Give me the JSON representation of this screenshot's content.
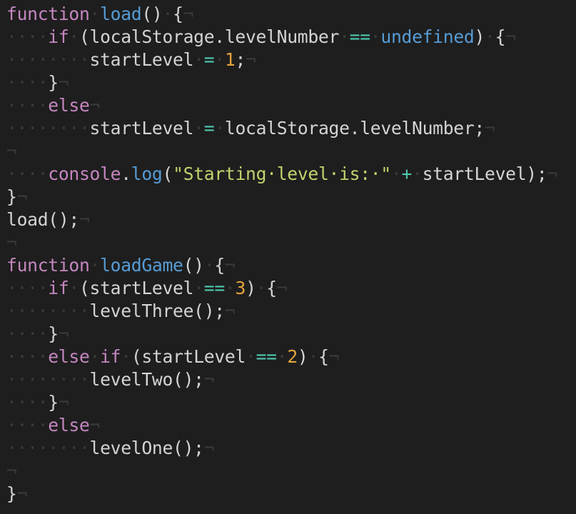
{
  "editor": {
    "lines": [
      [
        {
          "t": "function",
          "c": "kw"
        },
        {
          "t": "·",
          "c": "ws"
        },
        {
          "t": "load",
          "c": "fn"
        },
        {
          "t": "()",
          "c": "punc"
        },
        {
          "t": "·",
          "c": "ws"
        },
        {
          "t": "{",
          "c": "punc"
        },
        {
          "t": "¬",
          "c": "eol"
        }
      ],
      [
        {
          "t": "····",
          "c": "ws"
        },
        {
          "t": "if",
          "c": "kw"
        },
        {
          "t": "·",
          "c": "ws"
        },
        {
          "t": "(localStorage.levelNumber",
          "c": "punc"
        },
        {
          "t": "·",
          "c": "ws"
        },
        {
          "t": "==",
          "c": "op"
        },
        {
          "t": "·",
          "c": "ws"
        },
        {
          "t": "undefined",
          "c": "undef"
        },
        {
          "t": ")",
          "c": "punc"
        },
        {
          "t": "·",
          "c": "ws"
        },
        {
          "t": "{",
          "c": "punc"
        },
        {
          "t": "¬",
          "c": "eol"
        }
      ],
      [
        {
          "t": "········",
          "c": "ws"
        },
        {
          "t": "startLevel",
          "c": "punc"
        },
        {
          "t": "·",
          "c": "ws"
        },
        {
          "t": "=",
          "c": "op"
        },
        {
          "t": "·",
          "c": "ws"
        },
        {
          "t": "1",
          "c": "num"
        },
        {
          "t": ";",
          "c": "punc"
        },
        {
          "t": "¬",
          "c": "eol"
        }
      ],
      [
        {
          "t": "····",
          "c": "ws"
        },
        {
          "t": "}",
          "c": "punc"
        },
        {
          "t": "¬",
          "c": "eol"
        }
      ],
      [
        {
          "t": "····",
          "c": "ws"
        },
        {
          "t": "else",
          "c": "kw"
        },
        {
          "t": "¬",
          "c": "eol"
        }
      ],
      [
        {
          "t": "········",
          "c": "ws"
        },
        {
          "t": "startLevel",
          "c": "punc"
        },
        {
          "t": "·",
          "c": "ws"
        },
        {
          "t": "=",
          "c": "op"
        },
        {
          "t": "·",
          "c": "ws"
        },
        {
          "t": "localStorage.levelNumber;",
          "c": "punc"
        },
        {
          "t": "¬",
          "c": "eol"
        }
      ],
      [
        {
          "t": "¬",
          "c": "eol"
        }
      ],
      [
        {
          "t": "····",
          "c": "ws"
        },
        {
          "t": "console",
          "c": "kw"
        },
        {
          "t": ".",
          "c": "punc"
        },
        {
          "t": "log",
          "c": "fn"
        },
        {
          "t": "(",
          "c": "punc"
        },
        {
          "t": "\"Starting·level·is:·\"",
          "c": "str"
        },
        {
          "t": "·",
          "c": "ws"
        },
        {
          "t": "+",
          "c": "op"
        },
        {
          "t": "·",
          "c": "ws"
        },
        {
          "t": "startLevel);",
          "c": "punc"
        },
        {
          "t": "¬",
          "c": "eol"
        }
      ],
      [
        {
          "t": "}",
          "c": "punc"
        },
        {
          "t": "¬",
          "c": "eol"
        }
      ],
      [
        {
          "t": "load();",
          "c": "punc"
        },
        {
          "t": "¬",
          "c": "eol"
        }
      ],
      [
        {
          "t": "¬",
          "c": "eol"
        }
      ],
      [
        {
          "t": "function",
          "c": "kw"
        },
        {
          "t": "·",
          "c": "ws"
        },
        {
          "t": "loadGame",
          "c": "fn"
        },
        {
          "t": "()",
          "c": "punc"
        },
        {
          "t": "·",
          "c": "ws"
        },
        {
          "t": "{",
          "c": "punc"
        },
        {
          "t": "¬",
          "c": "eol"
        }
      ],
      [
        {
          "t": "····",
          "c": "ws"
        },
        {
          "t": "if",
          "c": "kw"
        },
        {
          "t": "·",
          "c": "ws"
        },
        {
          "t": "(startLevel",
          "c": "punc"
        },
        {
          "t": "·",
          "c": "ws"
        },
        {
          "t": "==",
          "c": "op"
        },
        {
          "t": "·",
          "c": "ws"
        },
        {
          "t": "3",
          "c": "num"
        },
        {
          "t": ")",
          "c": "punc"
        },
        {
          "t": "·",
          "c": "ws"
        },
        {
          "t": "{",
          "c": "punc"
        },
        {
          "t": "¬",
          "c": "eol"
        }
      ],
      [
        {
          "t": "········",
          "c": "ws"
        },
        {
          "t": "levelThree();",
          "c": "punc"
        },
        {
          "t": "¬",
          "c": "eol"
        }
      ],
      [
        {
          "t": "····",
          "c": "ws"
        },
        {
          "t": "}",
          "c": "punc"
        },
        {
          "t": "¬",
          "c": "eol"
        }
      ],
      [
        {
          "t": "····",
          "c": "ws"
        },
        {
          "t": "else",
          "c": "kw"
        },
        {
          "t": "·",
          "c": "ws"
        },
        {
          "t": "if",
          "c": "kw"
        },
        {
          "t": "·",
          "c": "ws"
        },
        {
          "t": "(startLevel",
          "c": "punc"
        },
        {
          "t": "·",
          "c": "ws"
        },
        {
          "t": "==",
          "c": "op"
        },
        {
          "t": "·",
          "c": "ws"
        },
        {
          "t": "2",
          "c": "num"
        },
        {
          "t": ")",
          "c": "punc"
        },
        {
          "t": "·",
          "c": "ws"
        },
        {
          "t": "{",
          "c": "punc"
        },
        {
          "t": "¬",
          "c": "eol"
        }
      ],
      [
        {
          "t": "········",
          "c": "ws"
        },
        {
          "t": "levelTwo();",
          "c": "punc"
        },
        {
          "t": "¬",
          "c": "eol"
        }
      ],
      [
        {
          "t": "····",
          "c": "ws"
        },
        {
          "t": "}",
          "c": "punc"
        },
        {
          "t": "¬",
          "c": "eol"
        }
      ],
      [
        {
          "t": "····",
          "c": "ws"
        },
        {
          "t": "else",
          "c": "kw"
        },
        {
          "t": "¬",
          "c": "eol"
        }
      ],
      [
        {
          "t": "········",
          "c": "ws"
        },
        {
          "t": "levelOne();",
          "c": "punc"
        },
        {
          "t": "¬",
          "c": "eol"
        }
      ],
      [
        {
          "t": "¬",
          "c": "eol"
        }
      ],
      [
        {
          "t": "}",
          "c": "punc"
        },
        {
          "t": "¬",
          "c": "eol"
        }
      ]
    ]
  },
  "colors": {
    "background": "#1e1e1e",
    "keyword": "#c586c0",
    "function_name": "#569cd6",
    "number": "#e5a33d",
    "string": "#c3d26e",
    "operator": "#4ec9b0",
    "whitespace_marker": "#3a3a3a"
  }
}
